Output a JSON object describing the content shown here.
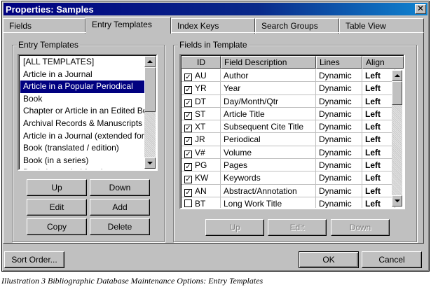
{
  "window": {
    "title": "Properties: Samples",
    "close_glyph": "✕"
  },
  "tabs": [
    {
      "label": "Fields"
    },
    {
      "label": "Entry Templates"
    },
    {
      "label": "Index Keys"
    },
    {
      "label": "Search Groups"
    },
    {
      "label": "Table View"
    }
  ],
  "entry_templates": {
    "group_label": "Entry Templates",
    "items": [
      "[ALL TEMPLATES]",
      "Article in a Journal",
      "Article in a Popular Periodical",
      "Book",
      "Chapter or Article in an Edited Bo",
      "Archival Records & Manuscripts",
      "Article in a Journal (extended form",
      "Book (translated / edition)",
      "Book (in a series)",
      "Book (extended form)"
    ],
    "selected_index": 2,
    "buttons": {
      "up": "Up",
      "down": "Down",
      "edit": "Edit",
      "add": "Add",
      "copy": "Copy",
      "delete": "Delete"
    }
  },
  "fields_in_template": {
    "group_label": "Fields in Template",
    "columns": [
      "ID",
      "Field Description",
      "Lines",
      "Align"
    ],
    "rows": [
      {
        "checked": true,
        "id": "AU",
        "description": "Author",
        "lines": "Dynamic",
        "align": "Left"
      },
      {
        "checked": true,
        "id": "YR",
        "description": "Year",
        "lines": "Dynamic",
        "align": "Left"
      },
      {
        "checked": true,
        "id": "DT",
        "description": "Day/Month/Qtr",
        "lines": "Dynamic",
        "align": "Left"
      },
      {
        "checked": true,
        "id": "ST",
        "description": "Article Title",
        "lines": "Dynamic",
        "align": "Left"
      },
      {
        "checked": true,
        "id": "XT",
        "description": "Subsequent Cite Title",
        "lines": "Dynamic",
        "align": "Left"
      },
      {
        "checked": true,
        "id": "JR",
        "description": "Periodical",
        "lines": "Dynamic",
        "align": "Left"
      },
      {
        "checked": true,
        "id": "V#",
        "description": "Volume",
        "lines": "Dynamic",
        "align": "Left"
      },
      {
        "checked": true,
        "id": "PG",
        "description": "Pages",
        "lines": "Dynamic",
        "align": "Left"
      },
      {
        "checked": true,
        "id": "KW",
        "description": "Keywords",
        "lines": "Dynamic",
        "align": "Left"
      },
      {
        "checked": true,
        "id": "AN",
        "description": "Abstract/Annotation",
        "lines": "Dynamic",
        "align": "Left"
      },
      {
        "checked": false,
        "id": "BT",
        "description": "Long Work Title",
        "lines": "Dynamic",
        "align": "Left"
      }
    ],
    "buttons": {
      "up": "Up",
      "edit": "Edit",
      "down": "Down"
    },
    "check_glyph": "✓"
  },
  "footer": {
    "sort_order": "Sort Order...",
    "ok": "OK",
    "cancel": "Cancel"
  },
  "caption": "Illustration 3 Bibliographic Database Maintenance Options: Entry Templates"
}
